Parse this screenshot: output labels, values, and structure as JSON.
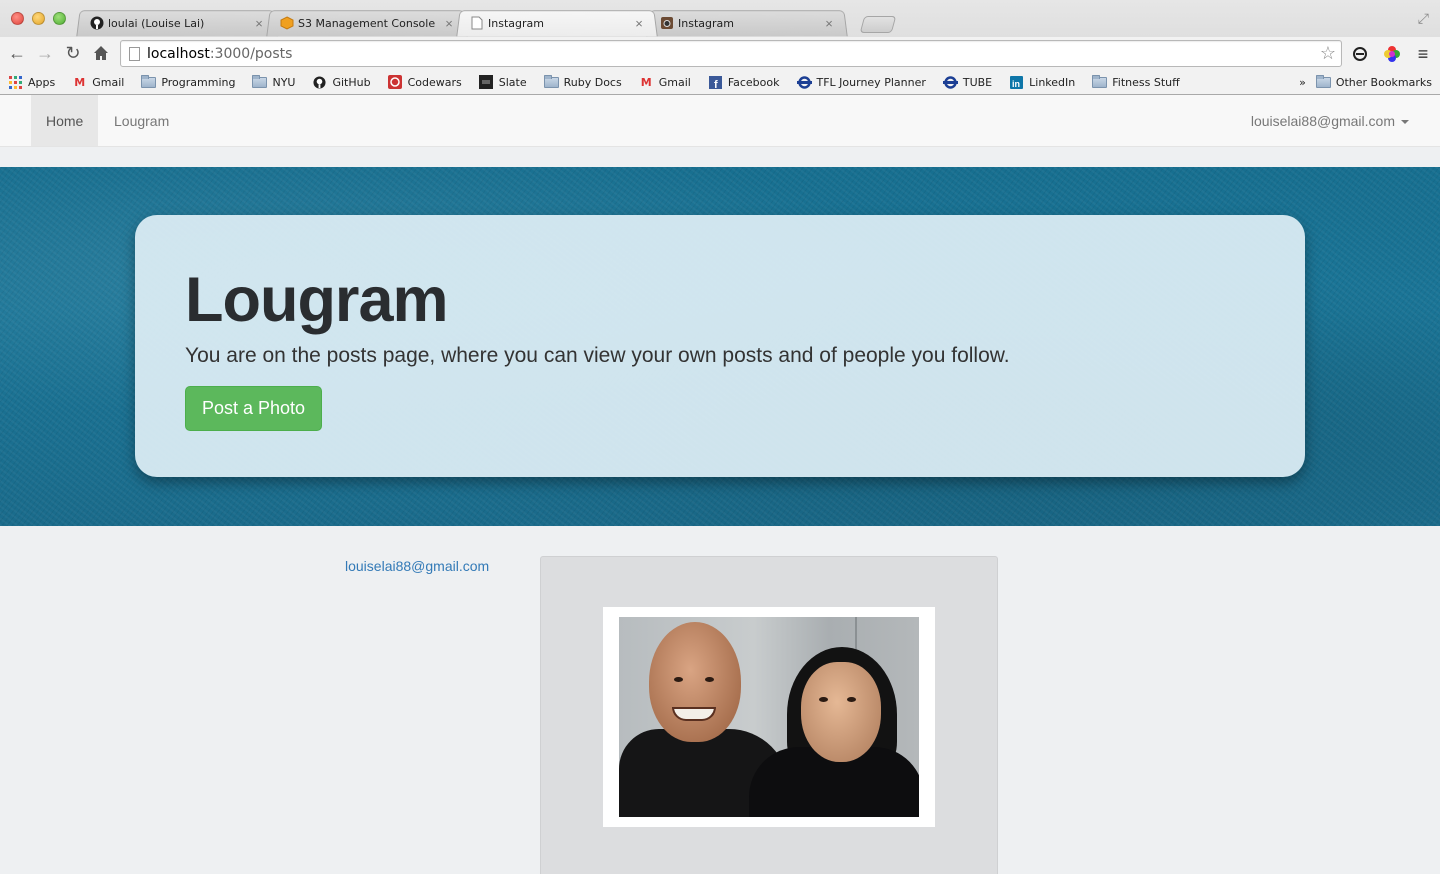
{
  "browser": {
    "tabs": [
      {
        "label": "loulai (Louise Lai)",
        "icon": "github-icon",
        "active": false
      },
      {
        "label": "S3 Management Console",
        "icon": "aws-cube-icon",
        "active": false
      },
      {
        "label": "Instagram",
        "icon": "page-icon",
        "active": true
      },
      {
        "label": "Instagram",
        "icon": "instagram-icon",
        "active": false
      }
    ],
    "url_host": "localhost",
    "url_path": ":3000/posts",
    "bookmarks": [
      {
        "label": "Apps",
        "icon": "apps-grid-icon"
      },
      {
        "label": "Gmail",
        "icon": "gmail-icon"
      },
      {
        "label": "Programming",
        "icon": "folder-icon"
      },
      {
        "label": "NYU",
        "icon": "folder-icon"
      },
      {
        "label": "GitHub",
        "icon": "github-icon"
      },
      {
        "label": "Codewars",
        "icon": "codewars-icon"
      },
      {
        "label": "Slate",
        "icon": "slate-icon"
      },
      {
        "label": "Ruby Docs",
        "icon": "folder-icon"
      },
      {
        "label": "Gmail",
        "icon": "gmail-icon"
      },
      {
        "label": "Facebook",
        "icon": "facebook-icon"
      },
      {
        "label": "TFL Journey Planner",
        "icon": "tfl-roundel-icon"
      },
      {
        "label": "TUBE",
        "icon": "tfl-roundel-icon"
      },
      {
        "label": "LinkedIn",
        "icon": "linkedin-icon"
      },
      {
        "label": "Fitness Stuff",
        "icon": "folder-icon"
      }
    ],
    "overflow_label": "»",
    "other_bookmarks": "Other Bookmarks"
  },
  "navbar": {
    "home": "Home",
    "brand": "Lougram",
    "user": "louiselai88@gmail.com"
  },
  "hero": {
    "title": "Lougram",
    "lead": "You are on the posts page, where you can view your own posts and of people you follow.",
    "button": "Post a Photo"
  },
  "post": {
    "author": "louiselai88@gmail.com"
  },
  "colors": {
    "button_green": "#5cb85c",
    "link_blue": "#337ab7",
    "hero_teal": "#1a7597"
  }
}
